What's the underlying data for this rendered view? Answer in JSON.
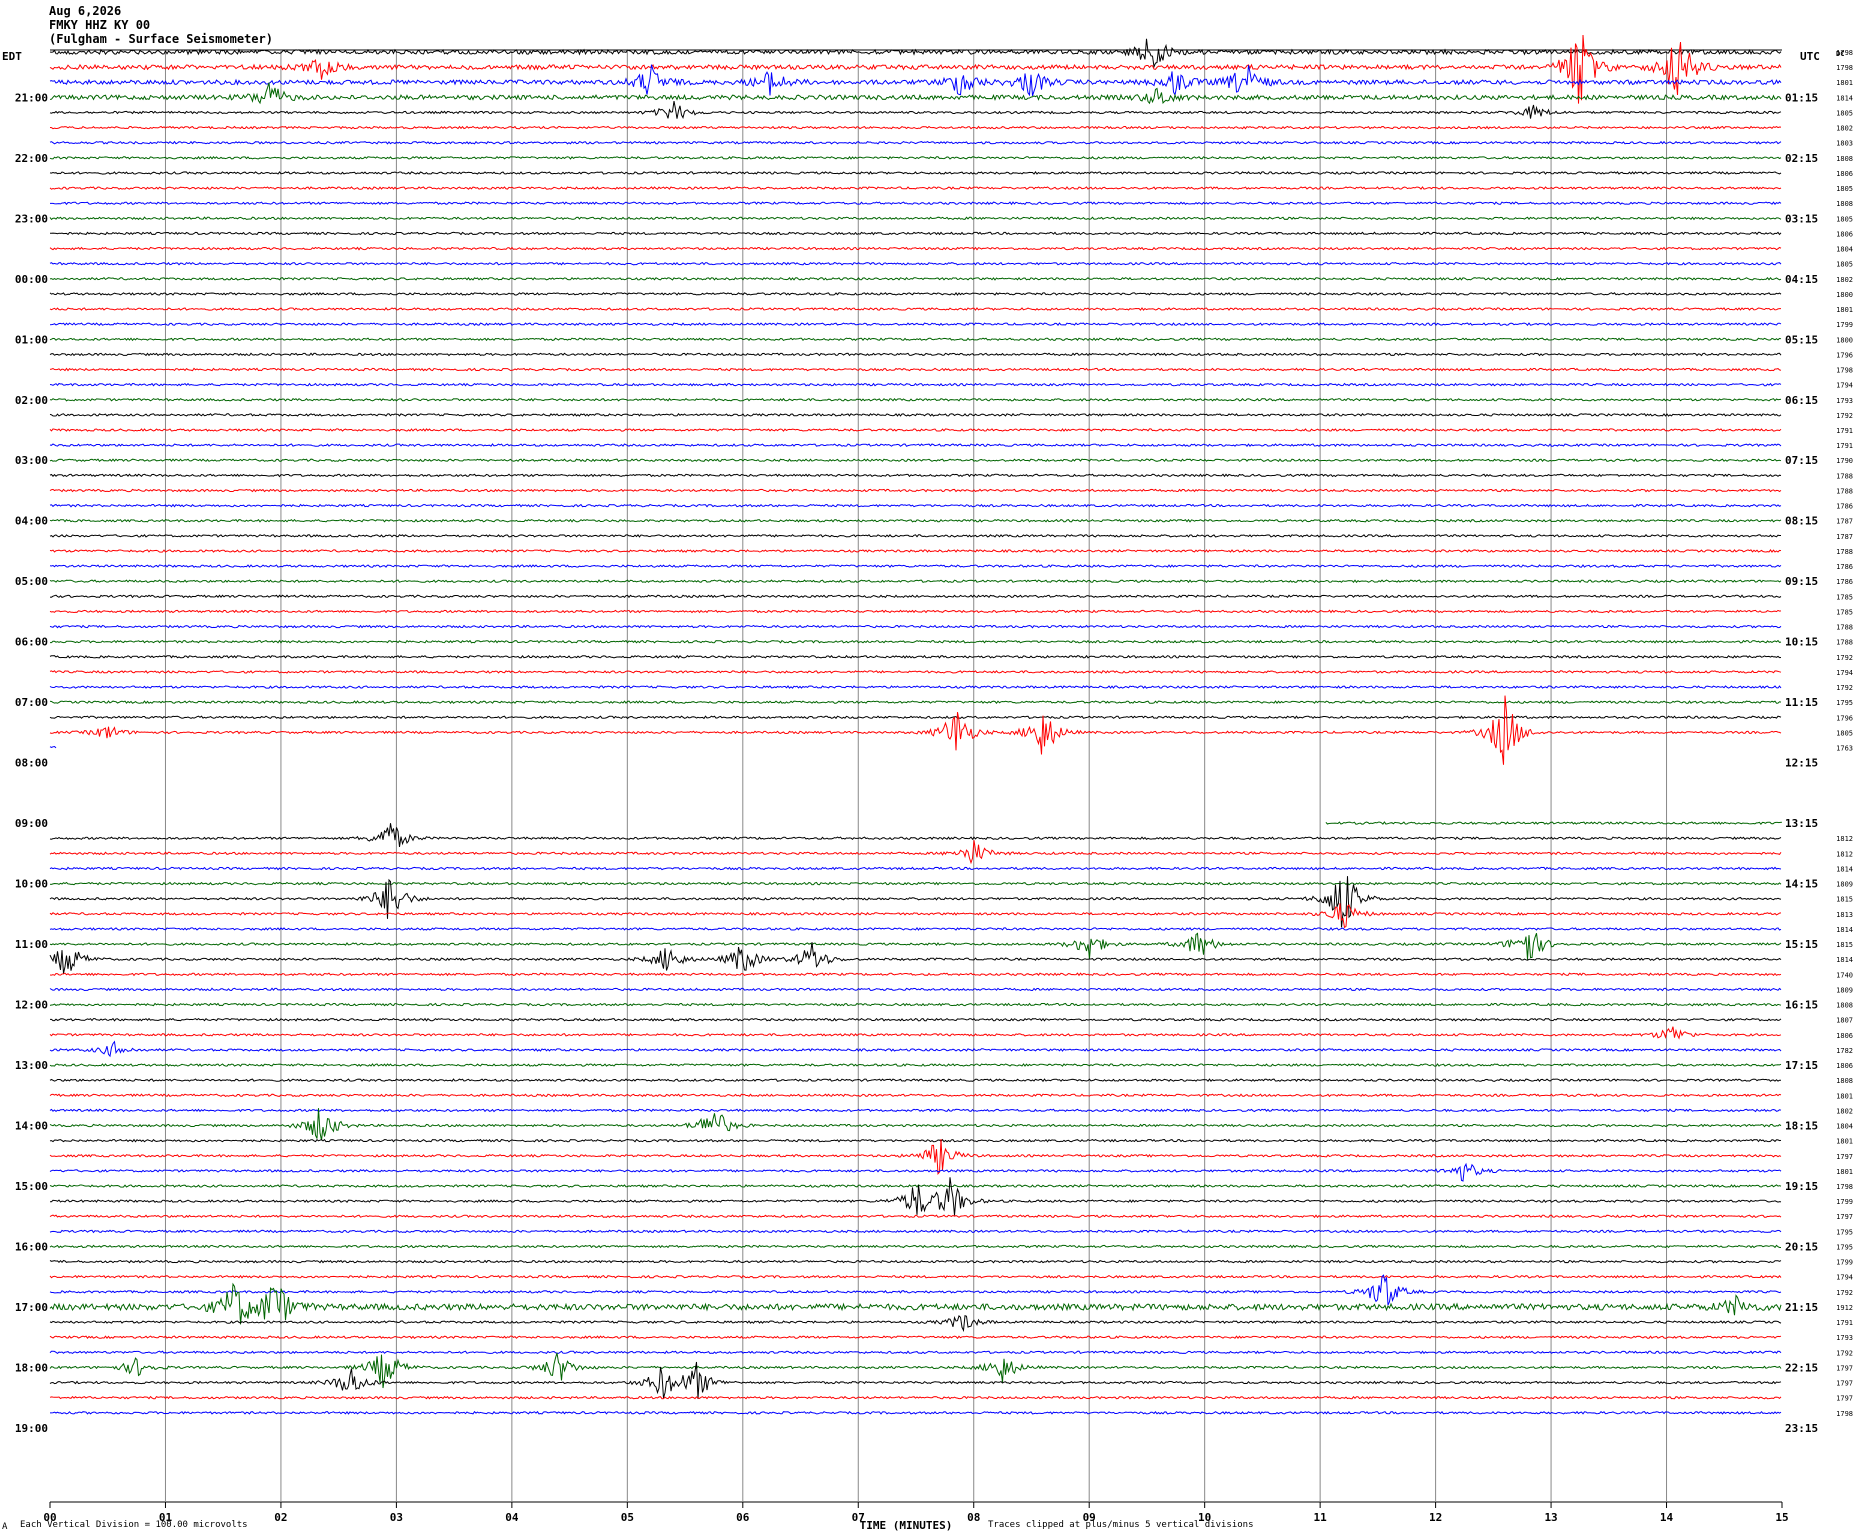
{
  "header": {
    "date": "Aug 6,2026",
    "station": "FMKY HHZ KY 00",
    "description": "(Fulgham - Surface Seismometer)"
  },
  "chart_data": {
    "type": "line",
    "title": "FMKY HHZ KY 00",
    "xlabel": "TIME (MINUTES)",
    "x_ticks": [
      "00",
      "01",
      "02",
      "03",
      "04",
      "05",
      "06",
      "07",
      "08",
      "09",
      "10",
      "11",
      "12",
      "13",
      "14",
      "15"
    ],
    "xlim": [
      0,
      15
    ],
    "left_axis_label": "EDT",
    "right_axis_label": "UTC",
    "dc_label": "DC",
    "edt_hours": [
      "21:00",
      "22:00",
      "23:00",
      "00:00",
      "01:00",
      "02:00",
      "03:00",
      "04:00",
      "05:00",
      "06:00",
      "07:00",
      "08:00",
      "09:00",
      "10:00",
      "11:00",
      "12:00",
      "13:00",
      "14:00",
      "15:00",
      "16:00",
      "17:00",
      "18:00",
      "19:00"
    ],
    "utc_hours": [
      "01:15",
      "02:15",
      "03:15",
      "04:15",
      "05:15",
      "06:15",
      "07:15",
      "08:15",
      "09:15",
      "10:15",
      "11:15",
      "12:15",
      "13:15",
      "14:15",
      "15:15",
      "16:15",
      "17:15",
      "18:15",
      "19:15",
      "20:15",
      "21:15",
      "22:15",
      "23:15"
    ],
    "trace_colors": [
      "#000000",
      "#ff0000",
      "#0000ff",
      "#006400"
    ],
    "dc_offsets_morning": [
      "1798",
      "1798",
      "1801",
      "1814",
      "1805",
      "1802",
      "1803",
      "1808",
      "1806",
      "1805",
      "1808",
      "1805",
      "1806",
      "1804",
      "1805",
      "1802",
      "1800",
      "1801",
      "1799",
      "1800",
      "1796",
      "1798",
      "1794",
      "1793",
      "1792",
      "1791",
      "1791",
      "1790",
      "1788",
      "1788",
      "1786",
      "1787",
      "1787",
      "1788",
      "1786",
      "1786",
      "1785",
      "1785",
      "1788",
      "1788",
      "1792",
      "1794",
      "1792",
      "1795",
      "1796",
      "1805",
      "1763"
    ],
    "dc_offsets_afternoon": [
      "1812",
      "1812",
      "1814",
      "1809",
      "1815",
      "1813",
      "1814",
      "1815",
      "1814",
      "1740",
      "1809",
      "1808",
      "1807",
      "1806",
      "1782",
      "1806",
      "1808",
      "1801",
      "1802",
      "1804",
      "1801",
      "1797",
      "1801",
      "1798",
      "1799",
      "1797",
      "1795",
      "1795",
      "1799",
      "1794",
      "1792",
      "1912",
      "1791",
      "1793",
      "1792",
      "1797",
      "1797",
      "1797",
      "1798"
    ],
    "events": [
      {
        "row": 0,
        "minute": 9.55,
        "amp": 22
      },
      {
        "row": 1,
        "minute": 13.25,
        "amp": 45
      },
      {
        "row": 1,
        "minute": 14.1,
        "amp": 45
      },
      {
        "row": 1,
        "minute": 2.35,
        "amp": 12
      },
      {
        "row": 2,
        "minute": 5.2,
        "amp": 18
      },
      {
        "row": 2,
        "minute": 6.25,
        "amp": 14
      },
      {
        "row": 2,
        "minute": 7.9,
        "amp": 16
      },
      {
        "row": 2,
        "minute": 8.5,
        "amp": 16
      },
      {
        "row": 2,
        "minute": 9.75,
        "amp": 14
      },
      {
        "row": 2,
        "minute": 10.35,
        "amp": 22
      },
      {
        "row": 3,
        "minute": 1.9,
        "amp": 16
      },
      {
        "row": 3,
        "minute": 9.6,
        "amp": 10
      },
      {
        "row": 4,
        "minute": 5.4,
        "amp": 12
      },
      {
        "row": 4,
        "minute": 12.85,
        "amp": 8
      },
      {
        "row": 45,
        "minute": 0.5,
        "amp": 8
      },
      {
        "row": 45,
        "minute": 7.85,
        "amp": 28
      },
      {
        "row": 45,
        "minute": 8.6,
        "amp": 28
      },
      {
        "row": 45,
        "minute": 12.6,
        "amp": 40
      },
      {
        "row": 52,
        "minute": 2.95,
        "amp": 20
      },
      {
        "row": 53,
        "minute": 8.0,
        "amp": 14
      },
      {
        "row": 56,
        "minute": 2.95,
        "amp": 28
      },
      {
        "row": 56,
        "minute": 11.2,
        "amp": 40
      },
      {
        "row": 57,
        "minute": 11.2,
        "amp": 16
      },
      {
        "row": 59,
        "minute": 9.0,
        "amp": 16
      },
      {
        "row": 59,
        "minute": 9.95,
        "amp": 16
      },
      {
        "row": 59,
        "minute": 12.8,
        "amp": 24
      },
      {
        "row": 60,
        "minute": 0.15,
        "amp": 20
      },
      {
        "row": 60,
        "minute": 5.35,
        "amp": 16
      },
      {
        "row": 60,
        "minute": 6.0,
        "amp": 18
      },
      {
        "row": 60,
        "minute": 6.6,
        "amp": 18
      },
      {
        "row": 65,
        "minute": 14.05,
        "amp": 10
      },
      {
        "row": 66,
        "minute": 0.55,
        "amp": 8
      },
      {
        "row": 71,
        "minute": 2.35,
        "amp": 22
      },
      {
        "row": 71,
        "minute": 5.75,
        "amp": 22
      },
      {
        "row": 73,
        "minute": 7.7,
        "amp": 20
      },
      {
        "row": 74,
        "minute": 12.25,
        "amp": 12
      },
      {
        "row": 76,
        "minute": 7.5,
        "amp": 20
      },
      {
        "row": 76,
        "minute": 7.8,
        "amp": 24
      },
      {
        "row": 82,
        "minute": 11.55,
        "amp": 24
      },
      {
        "row": 83,
        "minute": 1.6,
        "amp": 28
      },
      {
        "row": 83,
        "minute": 1.95,
        "amp": 32
      },
      {
        "row": 83,
        "minute": 14.6,
        "amp": 10
      },
      {
        "row": 84,
        "minute": 7.9,
        "amp": 10
      },
      {
        "row": 87,
        "minute": 0.75,
        "amp": 10
      },
      {
        "row": 87,
        "minute": 2.9,
        "amp": 24
      },
      {
        "row": 87,
        "minute": 4.4,
        "amp": 18
      },
      {
        "row": 87,
        "minute": 8.25,
        "amp": 16
      },
      {
        "row": 88,
        "minute": 2.6,
        "amp": 18
      },
      {
        "row": 88,
        "minute": 5.3,
        "amp": 18
      },
      {
        "row": 88,
        "minute": 5.6,
        "amp": 20
      }
    ]
  },
  "footer": {
    "vertical_division": "Each Vertical Division =  100.00 microvolts",
    "clip_note": "Traces clipped at plus/minus 5 vertical divisions",
    "corner_mark": "A"
  }
}
